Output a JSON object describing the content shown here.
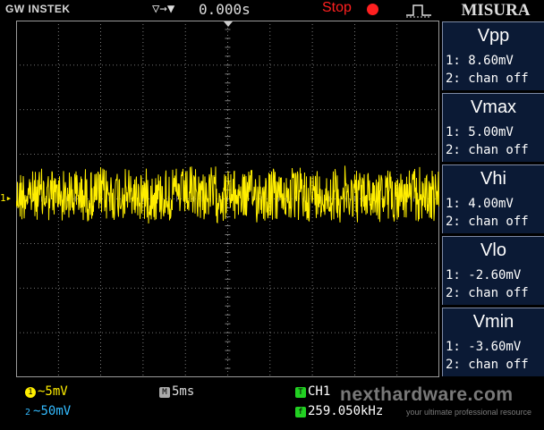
{
  "brand": "GW INSTEK",
  "trigger_mode_glyph": "▽→▼",
  "time_offset": "0.000s",
  "run_state": "Stop",
  "panel_title": "MISURA",
  "ch1_marker": "1▸",
  "measurements": [
    {
      "name": "Vpp",
      "ch1": "1: 8.60mV",
      "ch2": "2: chan off"
    },
    {
      "name": "Vmax",
      "ch1": "1: 5.00mV",
      "ch2": "2: chan off"
    },
    {
      "name": "Vhi",
      "ch1": "1: 4.00mV",
      "ch2": "2: chan off"
    },
    {
      "name": "Vlo",
      "ch1": "1: -2.60mV",
      "ch2": "2: chan off"
    },
    {
      "name": "Vmin",
      "ch1": "1: -3.60mV",
      "ch2": "2: chan off"
    }
  ],
  "bottom": {
    "ch1_badge": "1",
    "ch1_scale": "~5mV",
    "ch2_badge": "2",
    "ch2_scale": "~50mV",
    "timebase_badge": "M",
    "timebase": "5ms",
    "trigger_badge": "T",
    "trigger_source": "CH1",
    "freq_badge": "f",
    "frequency": "259.050kHz"
  },
  "watermark": "nexthardware.com",
  "watermark_sub": "your ultimate professional resource",
  "colors": {
    "ch1": "#ffee00",
    "ch2": "#33bbff",
    "grid": "#9a9a9a",
    "stop": "#ff2020",
    "panel": "#0b1a35"
  }
}
